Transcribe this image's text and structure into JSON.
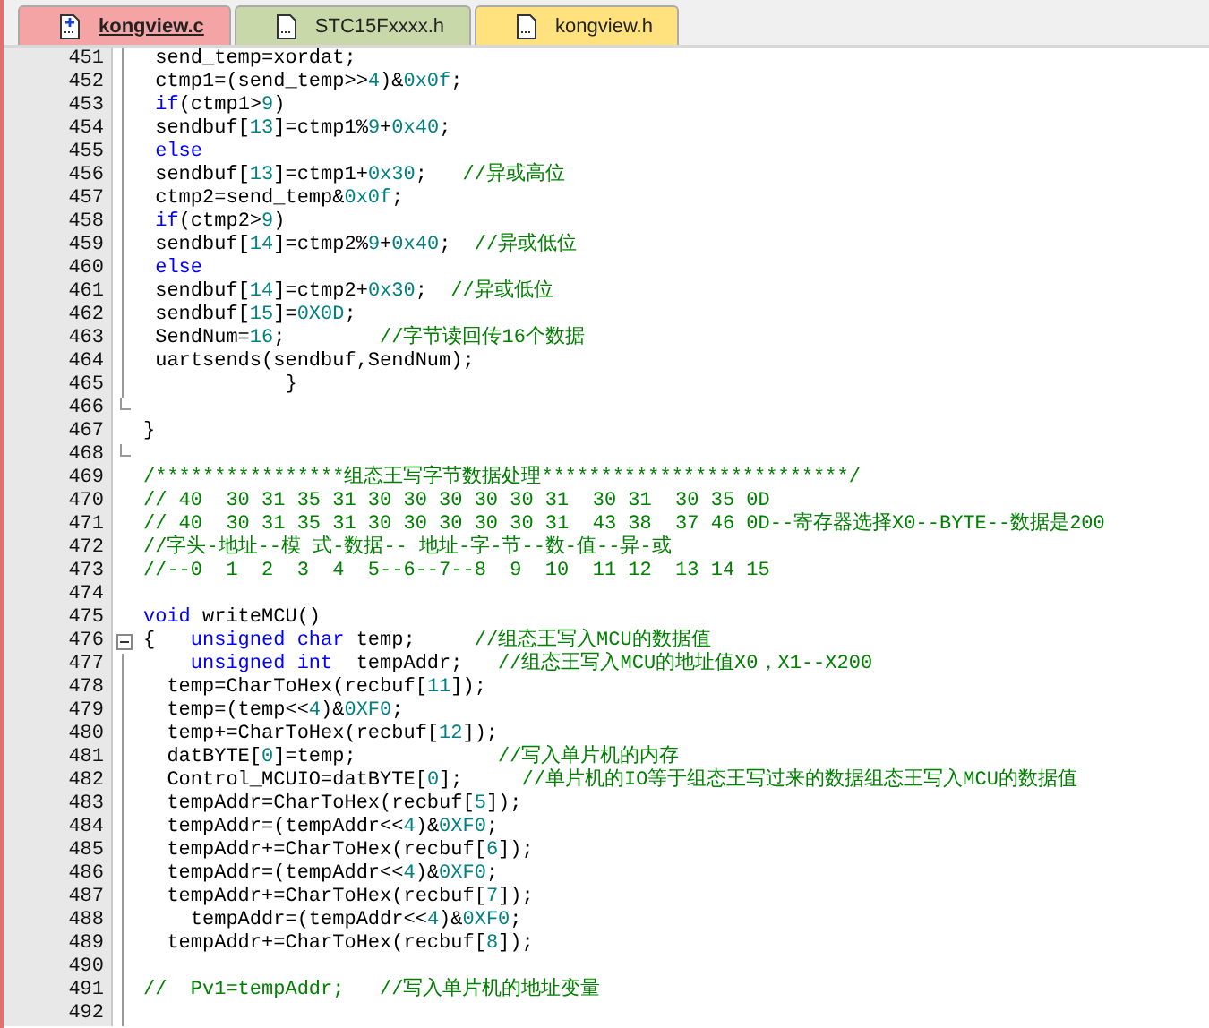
{
  "tabs": [
    {
      "label": "kongview.c",
      "selected": true,
      "color": "#f4a4a4"
    },
    {
      "label": "STC15Fxxxx.h",
      "selected": false,
      "color": "#c8d8a8"
    },
    {
      "label": "kongview.h",
      "selected": false,
      "color": "#ffe27e"
    }
  ],
  "lines": [
    {
      "number": "451",
      "kind": "code",
      "in_fold": true,
      "tokens": [
        {
          "kind": "code",
          "text": " send_temp=xordat;"
        }
      ]
    },
    {
      "number": "452",
      "kind": "code",
      "in_fold": true,
      "tokens": [
        {
          "kind": "code",
          "text": " ctmp1=(send_temp>>"
        },
        {
          "kind": "number",
          "text": "4"
        },
        {
          "kind": "code",
          "text": ")&"
        },
        {
          "kind": "number",
          "text": "0x0f"
        },
        {
          "kind": "code",
          "text": ";"
        }
      ]
    },
    {
      "number": "453",
      "kind": "code",
      "in_fold": true,
      "tokens": [
        {
          "kind": "keyword",
          "text": " if"
        },
        {
          "kind": "code",
          "text": "(ctmp1>"
        },
        {
          "kind": "number",
          "text": "9"
        },
        {
          "kind": "code",
          "text": ")"
        }
      ]
    },
    {
      "number": "454",
      "kind": "code",
      "in_fold": true,
      "tokens": [
        {
          "kind": "code",
          "text": " sendbuf["
        },
        {
          "kind": "number",
          "text": "13"
        },
        {
          "kind": "code",
          "text": "]=ctmp1%"
        },
        {
          "kind": "number",
          "text": "9"
        },
        {
          "kind": "code",
          "text": "+"
        },
        {
          "kind": "number",
          "text": "0x40"
        },
        {
          "kind": "code",
          "text": ";"
        }
      ]
    },
    {
      "number": "455",
      "kind": "code",
      "in_fold": true,
      "tokens": [
        {
          "kind": "keyword",
          "text": " else"
        }
      ]
    },
    {
      "number": "456",
      "kind": "code",
      "in_fold": true,
      "tokens": [
        {
          "kind": "code",
          "text": " sendbuf["
        },
        {
          "kind": "number",
          "text": "13"
        },
        {
          "kind": "code",
          "text": "]=ctmp1+"
        },
        {
          "kind": "number",
          "text": "0x30"
        },
        {
          "kind": "code",
          "text": ";   "
        },
        {
          "kind": "comment",
          "text": "//异或高位"
        }
      ]
    },
    {
      "number": "457",
      "kind": "code",
      "in_fold": true,
      "tokens": [
        {
          "kind": "code",
          "text": " ctmp2=send_temp&"
        },
        {
          "kind": "number",
          "text": "0x0f"
        },
        {
          "kind": "code",
          "text": ";"
        }
      ]
    },
    {
      "number": "458",
      "kind": "code",
      "in_fold": true,
      "tokens": [
        {
          "kind": "keyword",
          "text": " if"
        },
        {
          "kind": "code",
          "text": "(ctmp2>"
        },
        {
          "kind": "number",
          "text": "9"
        },
        {
          "kind": "code",
          "text": ")"
        }
      ]
    },
    {
      "number": "459",
      "kind": "code",
      "in_fold": true,
      "tokens": [
        {
          "kind": "code",
          "text": " sendbuf["
        },
        {
          "kind": "number",
          "text": "14"
        },
        {
          "kind": "code",
          "text": "]=ctmp2%"
        },
        {
          "kind": "number",
          "text": "9"
        },
        {
          "kind": "code",
          "text": "+"
        },
        {
          "kind": "number",
          "text": "0x40"
        },
        {
          "kind": "code",
          "text": ";  "
        },
        {
          "kind": "comment",
          "text": "//异或低位"
        }
      ]
    },
    {
      "number": "460",
      "kind": "code",
      "in_fold": true,
      "tokens": [
        {
          "kind": "keyword",
          "text": " else"
        }
      ]
    },
    {
      "number": "461",
      "kind": "code",
      "in_fold": true,
      "tokens": [
        {
          "kind": "code",
          "text": " sendbuf["
        },
        {
          "kind": "number",
          "text": "14"
        },
        {
          "kind": "code",
          "text": "]=ctmp2+"
        },
        {
          "kind": "number",
          "text": "0x30"
        },
        {
          "kind": "code",
          "text": ";  "
        },
        {
          "kind": "comment",
          "text": "//异或低位"
        }
      ]
    },
    {
      "number": "462",
      "kind": "code",
      "in_fold": true,
      "tokens": [
        {
          "kind": "code",
          "text": " sendbuf["
        },
        {
          "kind": "number",
          "text": "15"
        },
        {
          "kind": "code",
          "text": "]="
        },
        {
          "kind": "number",
          "text": "0X0D"
        },
        {
          "kind": "code",
          "text": ";"
        }
      ]
    },
    {
      "number": "463",
      "kind": "code",
      "in_fold": true,
      "tokens": [
        {
          "kind": "code",
          "text": " SendNum="
        },
        {
          "kind": "number",
          "text": "16"
        },
        {
          "kind": "code",
          "text": ";        "
        },
        {
          "kind": "comment",
          "text": "//字节读回传16个数据"
        }
      ]
    },
    {
      "number": "464",
      "kind": "code",
      "in_fold": true,
      "tokens": [
        {
          "kind": "code",
          "text": " uartsends(sendbuf,SendNum);"
        }
      ]
    },
    {
      "number": "465",
      "kind": "code",
      "in_fold": true,
      "tokens": [
        {
          "kind": "code",
          "text": "            }"
        }
      ]
    },
    {
      "number": "466",
      "kind": "fold-end",
      "in_fold": false
    },
    {
      "number": "467",
      "kind": "code",
      "in_fold": false,
      "tokens": [
        {
          "kind": "code",
          "text": "}"
        }
      ]
    },
    {
      "number": "468",
      "kind": "fold-end",
      "in_fold": false
    },
    {
      "number": "469",
      "kind": "code",
      "in_fold": false,
      "tokens": [
        {
          "kind": "comment",
          "text": "/****************组态王写字节数据处理**************************/"
        }
      ]
    },
    {
      "number": "470",
      "kind": "code",
      "in_fold": false,
      "tokens": [
        {
          "kind": "comment",
          "text": "// 40  30 31 35 31 30 30 30 30 30 31  30 31  30 35 0D"
        }
      ]
    },
    {
      "number": "471",
      "kind": "code",
      "in_fold": false,
      "tokens": [
        {
          "kind": "comment",
          "text": "// 40  30 31 35 31 30 30 30 30 30 31  43 38  37 46 0D--寄存器选择X0--BYTE--数据是200"
        }
      ]
    },
    {
      "number": "472",
      "kind": "code",
      "in_fold": false,
      "tokens": [
        {
          "kind": "comment",
          "text": "//字头-地址--模 式-数据-- 地址-字-节--数-值--异-或"
        }
      ]
    },
    {
      "number": "473",
      "kind": "code",
      "in_fold": false,
      "tokens": [
        {
          "kind": "comment",
          "text": "//--0  1  2  3  4  5--6--7--8  9  10  11 12  13 14 15"
        }
      ]
    },
    {
      "number": "474",
      "kind": "code",
      "in_fold": false
    },
    {
      "number": "475",
      "kind": "code",
      "in_fold": false,
      "tokens": [
        {
          "kind": "keyword",
          "text": "void"
        },
        {
          "kind": "code",
          "text": " writeMCU()"
        }
      ]
    },
    {
      "number": "476",
      "kind": "fold-start",
      "in_fold": false,
      "tokens": [
        {
          "kind": "code",
          "text": "{   "
        },
        {
          "kind": "keyword",
          "text": "unsigned char"
        },
        {
          "kind": "code",
          "text": " temp;     "
        },
        {
          "kind": "comment",
          "text": "//组态王写入MCU的数据值"
        }
      ]
    },
    {
      "number": "477",
      "kind": "code",
      "in_fold": true,
      "tokens": [
        {
          "kind": "keyword",
          "text": "    unsigned int"
        },
        {
          "kind": "code",
          "text": "  tempAddr;   "
        },
        {
          "kind": "comment",
          "text": "//组态王写入MCU的地址值X0，X1--X200"
        }
      ]
    },
    {
      "number": "478",
      "kind": "code",
      "in_fold": true,
      "tokens": [
        {
          "kind": "code",
          "text": "  temp=CharToHex(recbuf["
        },
        {
          "kind": "number",
          "text": "11"
        },
        {
          "kind": "code",
          "text": "]);"
        }
      ]
    },
    {
      "number": "479",
      "kind": "code",
      "in_fold": true,
      "tokens": [
        {
          "kind": "code",
          "text": "  temp=(temp<<"
        },
        {
          "kind": "number",
          "text": "4"
        },
        {
          "kind": "code",
          "text": ")&"
        },
        {
          "kind": "number",
          "text": "0XF0"
        },
        {
          "kind": "code",
          "text": ";"
        }
      ]
    },
    {
      "number": "480",
      "kind": "code",
      "in_fold": true,
      "tokens": [
        {
          "kind": "code",
          "text": "  temp+=CharToHex(recbuf["
        },
        {
          "kind": "number",
          "text": "12"
        },
        {
          "kind": "code",
          "text": "]);"
        }
      ]
    },
    {
      "number": "481",
      "kind": "code",
      "in_fold": true,
      "tokens": [
        {
          "kind": "code",
          "text": "  datBYTE["
        },
        {
          "kind": "number",
          "text": "0"
        },
        {
          "kind": "code",
          "text": "]=temp;            "
        },
        {
          "kind": "comment",
          "text": "//写入单片机的内存"
        }
      ]
    },
    {
      "number": "482",
      "kind": "code",
      "in_fold": true,
      "tokens": [
        {
          "kind": "code",
          "text": "  Control_MCUIO=datBYTE["
        },
        {
          "kind": "number",
          "text": "0"
        },
        {
          "kind": "code",
          "text": "];     "
        },
        {
          "kind": "comment",
          "text": "//单片机的IO等于组态王写过来的数据组态王写入MCU的数据值"
        }
      ]
    },
    {
      "number": "483",
      "kind": "code",
      "in_fold": true,
      "tokens": [
        {
          "kind": "code",
          "text": "  tempAddr=CharToHex(recbuf["
        },
        {
          "kind": "number",
          "text": "5"
        },
        {
          "kind": "code",
          "text": "]);"
        }
      ]
    },
    {
      "number": "484",
      "kind": "code",
      "in_fold": true,
      "tokens": [
        {
          "kind": "code",
          "text": "  tempAddr=(tempAddr<<"
        },
        {
          "kind": "number",
          "text": "4"
        },
        {
          "kind": "code",
          "text": ")&"
        },
        {
          "kind": "number",
          "text": "0XF0"
        },
        {
          "kind": "code",
          "text": ";"
        }
      ]
    },
    {
      "number": "485",
      "kind": "code",
      "in_fold": true,
      "tokens": [
        {
          "kind": "code",
          "text": "  tempAddr+=CharToHex(recbuf["
        },
        {
          "kind": "number",
          "text": "6"
        },
        {
          "kind": "code",
          "text": "]);"
        }
      ]
    },
    {
      "number": "486",
      "kind": "code",
      "in_fold": true,
      "tokens": [
        {
          "kind": "code",
          "text": "  tempAddr=(tempAddr<<"
        },
        {
          "kind": "number",
          "text": "4"
        },
        {
          "kind": "code",
          "text": ")&"
        },
        {
          "kind": "number",
          "text": "0XF0"
        },
        {
          "kind": "code",
          "text": ";"
        }
      ]
    },
    {
      "number": "487",
      "kind": "code",
      "in_fold": true,
      "tokens": [
        {
          "kind": "code",
          "text": "  tempAddr+=CharToHex(recbuf["
        },
        {
          "kind": "number",
          "text": "7"
        },
        {
          "kind": "code",
          "text": "]);"
        }
      ]
    },
    {
      "number": "488",
      "kind": "code",
      "in_fold": true,
      "tokens": [
        {
          "kind": "code",
          "text": "    tempAddr=(tempAddr<<"
        },
        {
          "kind": "number",
          "text": "4"
        },
        {
          "kind": "code",
          "text": ")&"
        },
        {
          "kind": "number",
          "text": "0XF0"
        },
        {
          "kind": "code",
          "text": ";"
        }
      ]
    },
    {
      "number": "489",
      "kind": "code",
      "in_fold": true,
      "tokens": [
        {
          "kind": "code",
          "text": "  tempAddr+=CharToHex(recbuf["
        },
        {
          "kind": "number",
          "text": "8"
        },
        {
          "kind": "code",
          "text": "]);"
        }
      ]
    },
    {
      "number": "490",
      "kind": "code",
      "in_fold": true
    },
    {
      "number": "491",
      "kind": "code",
      "in_fold": true,
      "tokens": [
        {
          "kind": "comment",
          "text": "//  Pv1=tempAddr;   //写入单片机的地址变量"
        }
      ]
    },
    {
      "number": "492",
      "kind": "code",
      "in_fold": true
    }
  ]
}
